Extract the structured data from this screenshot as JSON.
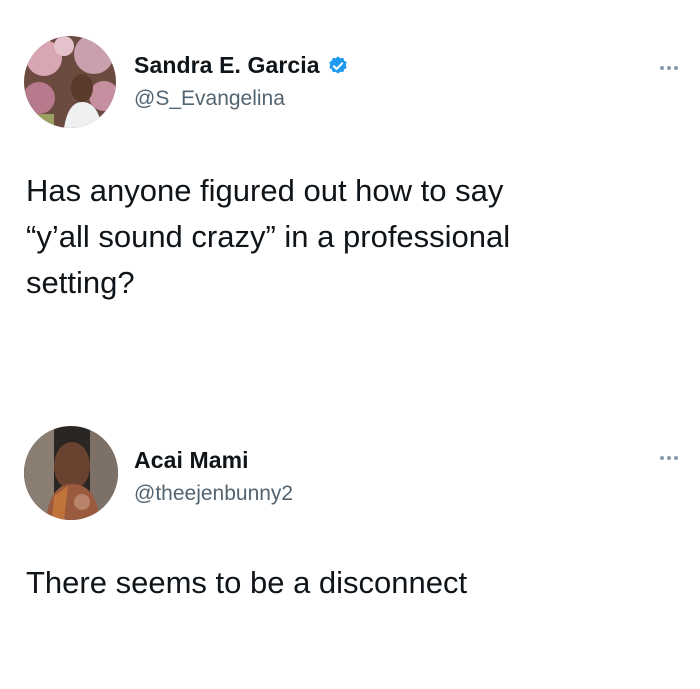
{
  "tweets": [
    {
      "display_name": "Sandra E. Garcia",
      "handle": "@S_Evangelina",
      "verified": true,
      "text_lines": [
        "Has anyone figured out how to say",
        "“y’all sound crazy” in a professional",
        "setting?"
      ],
      "avatar_icon": "profile-photo-cherry-blossoms"
    },
    {
      "display_name": "Acai Mami",
      "handle": "@theejenbunny2",
      "verified": false,
      "text_lines": [
        "There seems to be a disconnect"
      ],
      "avatar_icon": "profile-photo-selfie"
    }
  ],
  "colors": {
    "name": "#0f1419",
    "handle": "#536471",
    "verified_badge": "#1d9bf0",
    "more_dots": "#8b98a5"
  }
}
